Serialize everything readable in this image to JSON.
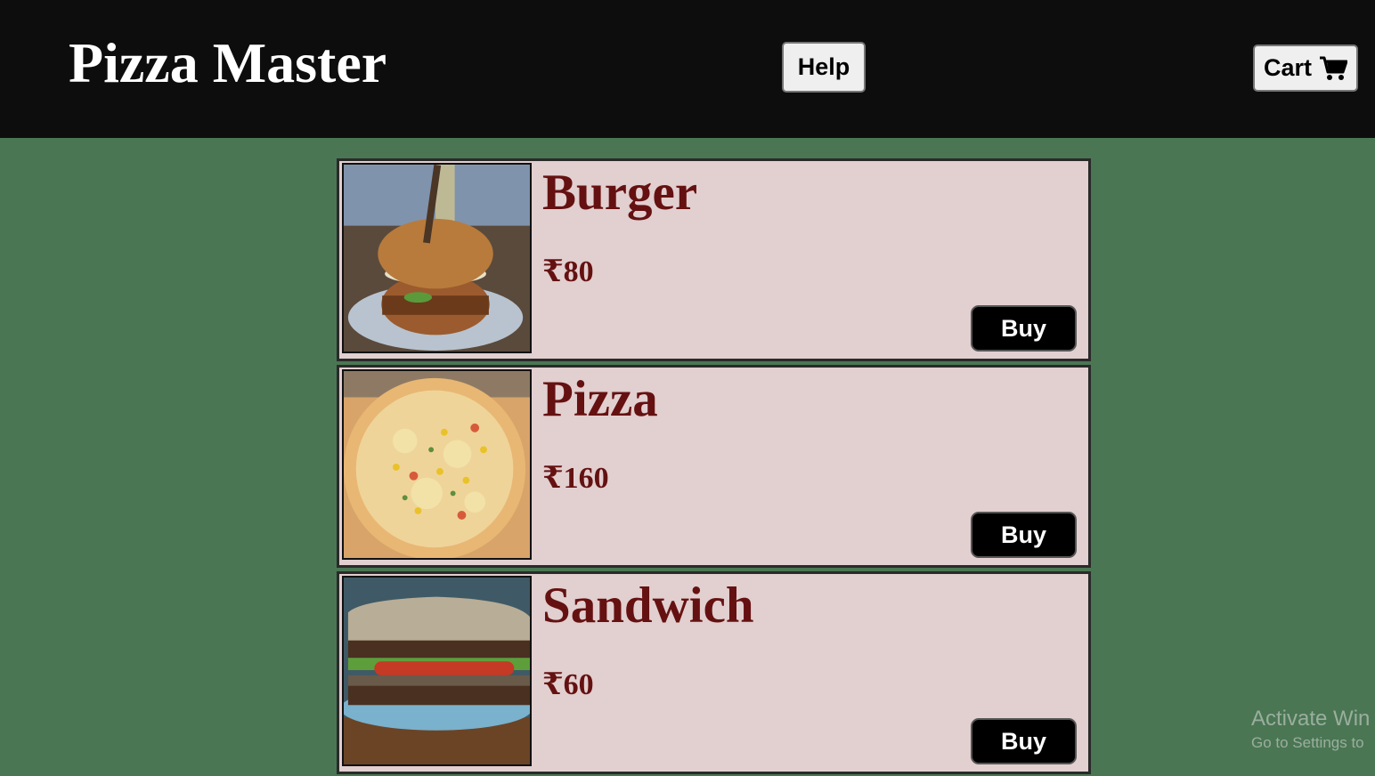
{
  "header": {
    "title": "Pizza Master",
    "help_label": "Help",
    "cart_label": "Cart",
    "cart_icon": "shopping-cart-icon"
  },
  "menu": {
    "items": [
      {
        "name": "Burger",
        "price": "₹80",
        "buy_label": "Buy",
        "image": "burger-photo"
      },
      {
        "name": "Pizza",
        "price": "₹160",
        "buy_label": "Buy",
        "image": "pizza-photo"
      },
      {
        "name": "Sandwich",
        "price": "₹60",
        "buy_label": "Buy",
        "image": "sandwich-photo"
      }
    ]
  },
  "watermark": {
    "title": "Activate Win",
    "subtitle": "Go to Settings to"
  },
  "colors": {
    "page_background": "#4a7653",
    "header_background": "#0e0d0d",
    "card_background": "#e2cfd0",
    "item_text": "#651111",
    "buy_button": "#000000"
  }
}
